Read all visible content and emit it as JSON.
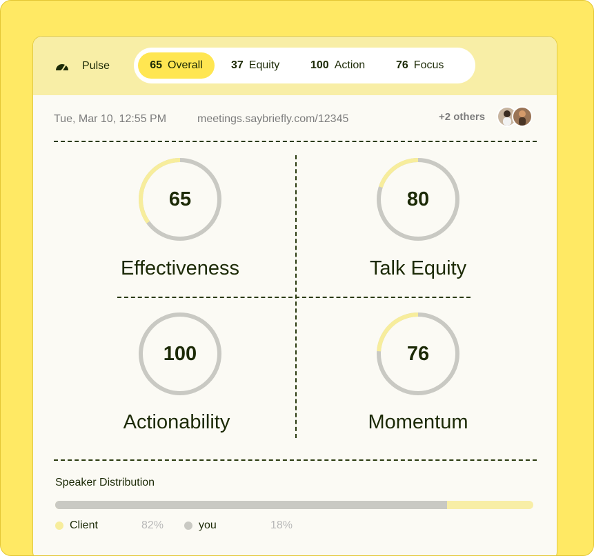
{
  "header": {
    "brand_label": "Pulse",
    "brand_icon": "gauge-icon",
    "tabs": [
      {
        "num": "65",
        "label": "Overall",
        "active": true
      },
      {
        "num": "37",
        "label": "Equity",
        "active": false
      },
      {
        "num": "100",
        "label": "Action",
        "active": false
      },
      {
        "num": "76",
        "label": "Focus",
        "active": false
      }
    ]
  },
  "meeting": {
    "datetime": "Tue, Mar 10, 12:55 PM",
    "url": "meetings.saybriefly.com/12345",
    "participants": "+2 others"
  },
  "metrics": [
    {
      "label": "Effectiveness",
      "value": "65"
    },
    {
      "label": "Talk Equity",
      "value": "80"
    },
    {
      "label": "Actionability",
      "value": "100"
    },
    {
      "label": "Momentum",
      "value": "76"
    }
  ],
  "speaker_distribution": {
    "title": "Speaker Distribution",
    "client_label": "Client",
    "client_pct": "82%",
    "client_fraction": 0.82,
    "you_label": "you",
    "you_pct": "18%"
  },
  "colors": {
    "background": "#ffe964",
    "accent": "#ffe651",
    "header_band": "#f8eea6",
    "ring_track": "#c9c9c3",
    "ring_highlight": "#f7ed9c",
    "text_dark": "#1c2a06",
    "text_muted": "#7d7d7d"
  }
}
